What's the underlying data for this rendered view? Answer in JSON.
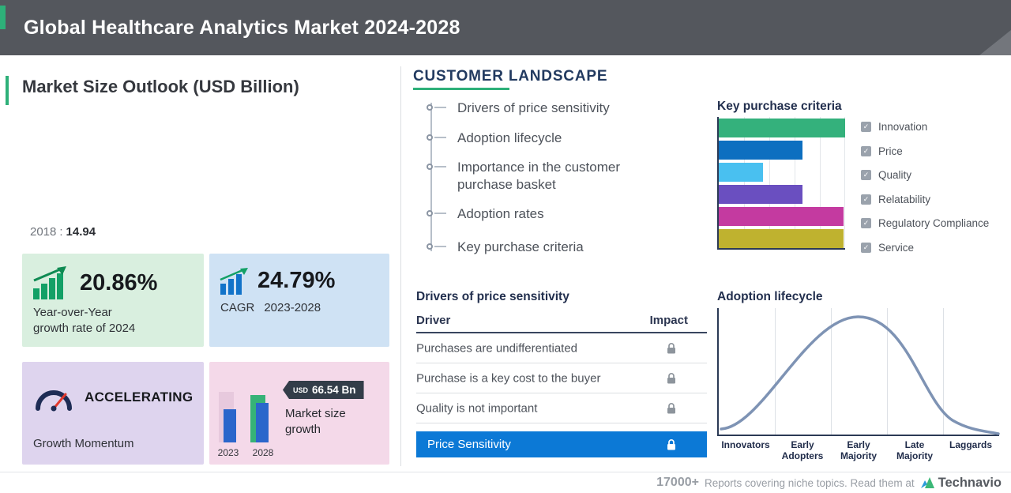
{
  "header": {
    "title": "Global Healthcare Analytics Market 2024-2028"
  },
  "market_outlook": {
    "title": "Market Size Outlook (USD Billion)",
    "base_year": "2018",
    "separator": ":",
    "base_value": "14.94",
    "yoy_card": {
      "value": "20.86%",
      "desc_line1": "Year-over-Year",
      "desc_line2": "growth rate of 2024",
      "bg": "#d9efdf"
    },
    "cagr_card": {
      "value": "24.79%",
      "label": "CAGR",
      "period": "2023-2028",
      "bg": "#cfe2f4"
    },
    "momentum_card": {
      "value": "ACCELERATING",
      "label": "Growth Momentum",
      "bg": "#ded4ee"
    },
    "size_card": {
      "badge_currency": "USD",
      "badge_value": "66.54 Bn",
      "desc_line1": "Market size",
      "desc_line2": "growth",
      "year_start": "2023",
      "year_end": "2028",
      "bg": "#f4d9e9"
    }
  },
  "customer_landscape": {
    "title": "CUSTOMER LANDSCAPE",
    "timeline": [
      "Drivers of price sensitivity",
      "Adoption lifecycle",
      "Importance in the customer purchase basket",
      "Adoption rates",
      "Key purchase criteria"
    ]
  },
  "drivers_table": {
    "title": "Drivers of price sensitivity",
    "col_driver": "Driver",
    "col_impact": "Impact",
    "rows": [
      "Purchases are undifferentiated",
      "Purchase is a key cost to the buyer",
      "Quality is not important"
    ],
    "highlight": "Price Sensitivity",
    "highlight_bg": "#0c79d6"
  },
  "chart_data": [
    {
      "type": "bar",
      "title": "Key purchase criteria",
      "orientation": "horizontal",
      "categories": [
        "Innovation",
        "Price",
        "Quality",
        "Relatability",
        "Regulatory Compliance",
        "Service"
      ],
      "values": [
        100,
        66,
        35,
        66,
        99,
        99
      ],
      "value_note": "relative bar length in % of longest bar; no numeric axis labels shown",
      "colors": [
        "#34b17c",
        "#0d6fc0",
        "#49c0f0",
        "#6a4fc0",
        "#c43aa0",
        "#bfb22f"
      ],
      "legend_position": "right",
      "grid": true
    },
    {
      "type": "line",
      "title": "Adoption lifecycle",
      "shape": "bell curve",
      "categories": [
        "Innovators",
        "Early Adopters",
        "Early Majority",
        "Late Majority",
        "Laggards"
      ],
      "line_color": "#7e93b4",
      "grid": true
    },
    {
      "type": "bar",
      "title": "Market size growth",
      "categories": [
        "2023",
        "2028"
      ],
      "annotation": "USD 66.54 Bn",
      "colors": [
        "#2a66cb",
        "#36b277"
      ]
    }
  ],
  "footer": {
    "count": "17000+",
    "text": "Reports covering niche topics. Read them at",
    "brand": "Technavio"
  },
  "icons": {
    "check_glyph": "✓",
    "lock": "padlock",
    "yoy_icon": "bar-chart-with-up-arrow",
    "cagr_icon": "bar-chart-with-up-arrow",
    "momentum_icon": "speedometer-gauge",
    "brand_icon": "technavio-arrows-mark"
  },
  "theme": {
    "header_bg": "#54575d",
    "accent_green": "#2eb079",
    "navy": "#223a60",
    "axis_color": "#2b3a55"
  }
}
